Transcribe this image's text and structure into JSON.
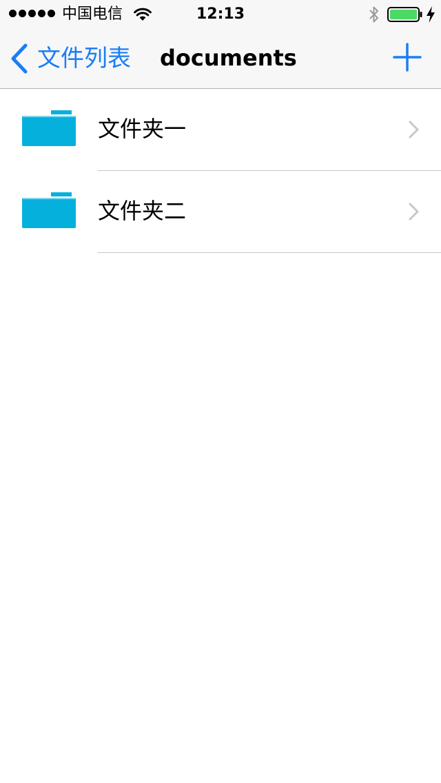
{
  "status_bar": {
    "signal_dots": 5,
    "carrier": "中国电信",
    "time": "12:13",
    "icons": [
      "wifi-icon",
      "bluetooth-icon",
      "battery-icon",
      "charging-icon"
    ],
    "battery_color": "#4cd964"
  },
  "nav_bar": {
    "back_label": "文件列表",
    "title": "documents",
    "add_icon": "plus-icon"
  },
  "colors": {
    "accent": "#1a7ef5",
    "folder": "#06b0dd",
    "separator": "#c8c7cc",
    "chevron": "#c7c7cc"
  },
  "files": [
    {
      "name": "文件夹一",
      "icon": "folder-icon"
    },
    {
      "name": "文件夹二",
      "icon": "folder-icon"
    }
  ]
}
